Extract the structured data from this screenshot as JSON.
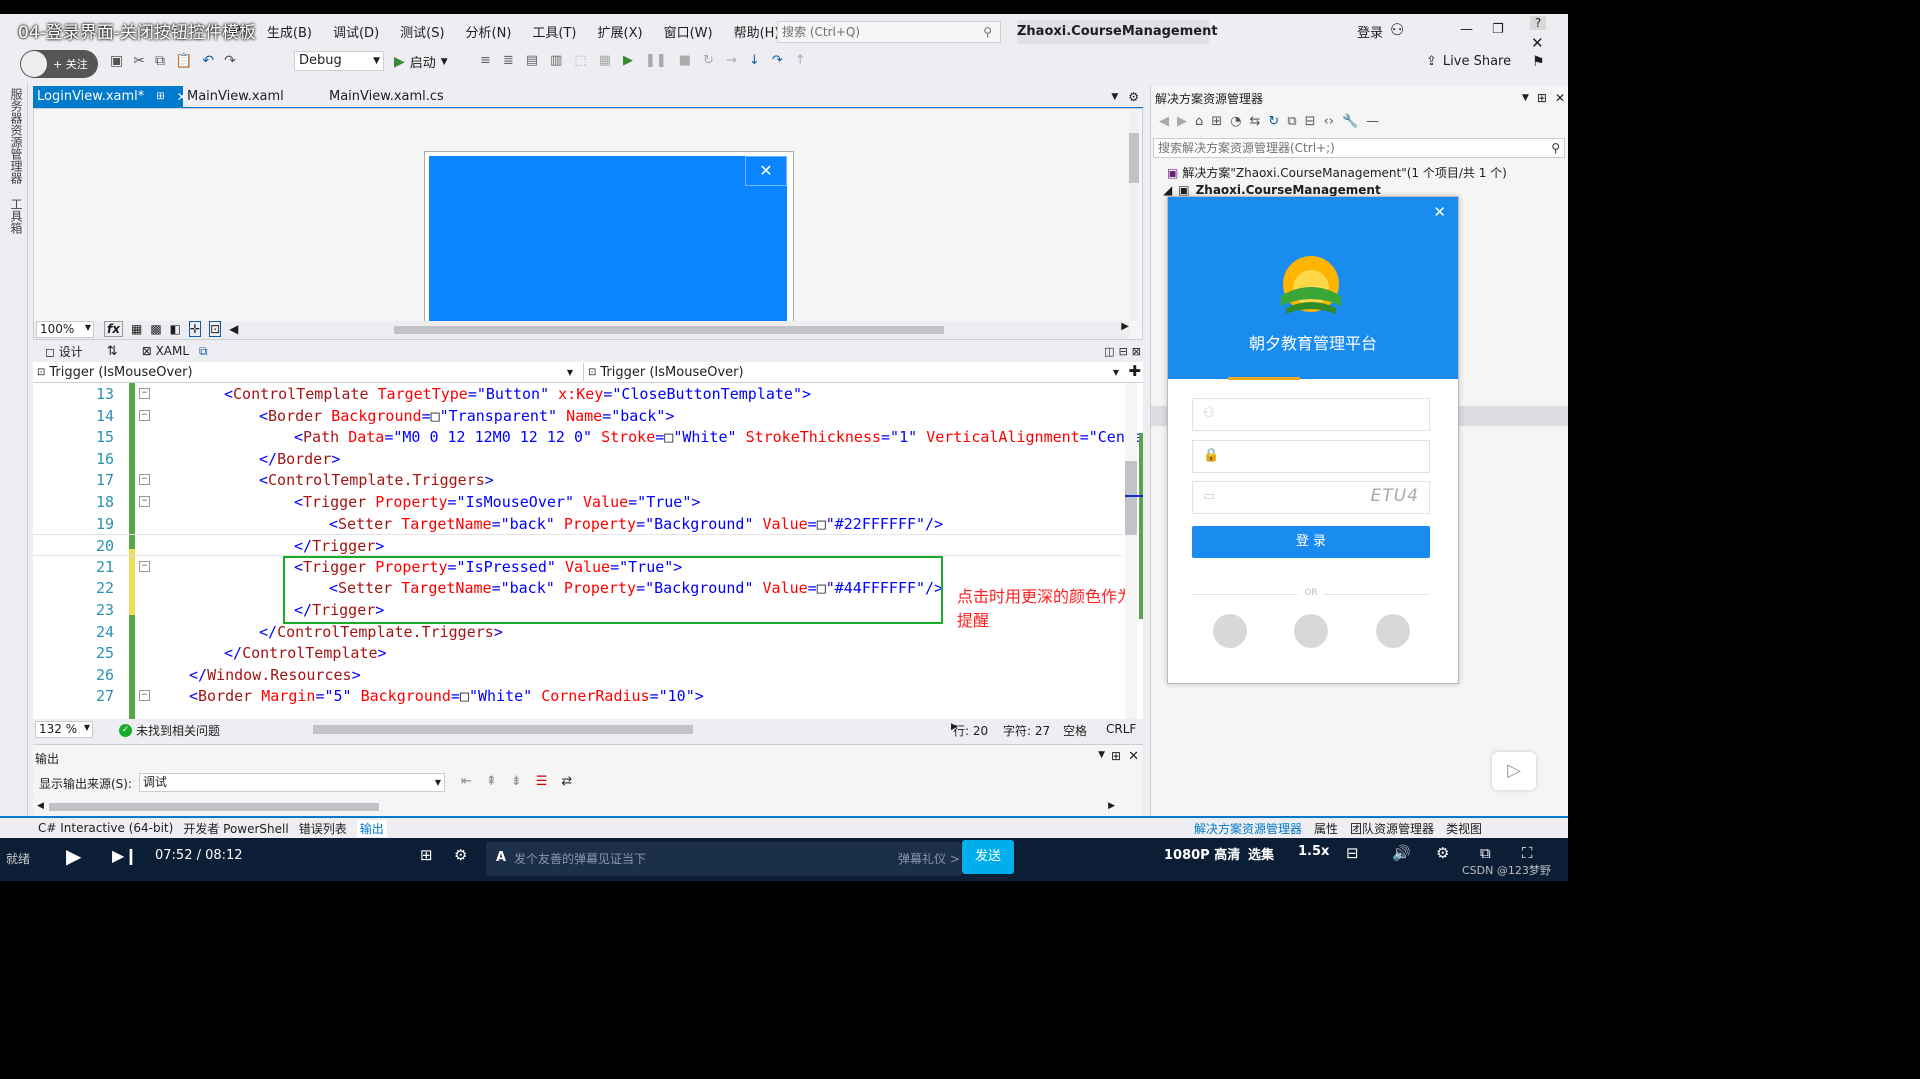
{
  "video_title": "04-登录界面-关闭按钮控件模板",
  "menu": [
    "P)",
    "生成(B)",
    "调试(D)",
    "测试(S)",
    "分析(N)",
    "工具(T)",
    "扩展(X)",
    "窗口(W)",
    "帮助(H)"
  ],
  "search_placeholder": "搜索 (Ctrl+Q)",
  "project_name": "Zhaoxi.CourseManagement",
  "login_label": "登录",
  "follow_label": "+ 关注",
  "config": "Debug",
  "start_label": "启动",
  "live_share": "Live Share",
  "left_strip": [
    "服务器资源管理器",
    "工具箱"
  ],
  "tabs": [
    {
      "label": "LoginView.xaml*",
      "active": true
    },
    {
      "label": "MainView.xaml",
      "active": false
    },
    {
      "label": "MainView.xaml.cs",
      "active": false
    }
  ],
  "designer": {
    "zoom": "100%",
    "design_tab": "设计",
    "xaml_tab": "XAML"
  },
  "combo_left": "Trigger (IsMouseOver)",
  "combo_right": "Trigger (IsMouseOver)",
  "code_lines": [
    {
      "n": "13",
      "html": "<span class=\"p\">&lt;</span><span class=\"t\">ControlTemplate</span> <span class=\"a\">TargetType</span><span class=\"p\">=\"</span><span class=\"v\">Button</span><span class=\"p\">\"</span> <span class=\"a\">x:Key</span><span class=\"p\">=\"</span><span class=\"v\">CloseButtonTemplate</span><span class=\"p\">\"&gt;</span>",
      "indent": 2
    },
    {
      "n": "14",
      "html": "<span class=\"p\">&lt;</span><span class=\"t\">Border</span> <span class=\"a\">Background</span><span class=\"p\">=</span>□<span class=\"p\">\"</span><span class=\"v\">Transparent</span><span class=\"p\">\"</span> <span class=\"a\">Name</span><span class=\"p\">=\"</span><span class=\"v\">back</span><span class=\"p\">\"&gt;</span>",
      "indent": 3
    },
    {
      "n": "15",
      "html": "<span class=\"p\">&lt;</span><span class=\"t\">Path</span> <span class=\"a\">Data</span><span class=\"p\">=\"</span><span class=\"v\">M0 0 12 12M0 12 12 0</span><span class=\"p\">\"</span> <span class=\"a\">Stroke</span><span class=\"p\">=</span>□<span class=\"p\">\"</span><span class=\"v\">White</span><span class=\"p\">\"</span> <span class=\"a\">StrokeThickness</span><span class=\"p\">=\"</span><span class=\"v\">1</span><span class=\"p\">\"</span> <span class=\"a\">VerticalAlignment</span><span class=\"p\">=\"</span><span class=\"v\">Cente</span>",
      "indent": 4
    },
    {
      "n": "16",
      "html": "<span class=\"p\">&lt;/</span><span class=\"t\">Border</span><span class=\"p\">&gt;</span>",
      "indent": 3
    },
    {
      "n": "17",
      "html": "<span class=\"p\">&lt;</span><span class=\"t\">ControlTemplate.Triggers</span><span class=\"p\">&gt;</span>",
      "indent": 3
    },
    {
      "n": "18",
      "html": "<span class=\"p\">&lt;</span><span class=\"t\">Trigger</span> <span class=\"a\">Property</span><span class=\"p\">=\"</span><span class=\"v\">IsMouseOver</span><span class=\"p\">\"</span> <span class=\"a\">Value</span><span class=\"p\">=\"</span><span class=\"v\">True</span><span class=\"p\">\"&gt;</span>",
      "indent": 4
    },
    {
      "n": "19",
      "html": "<span class=\"p\">&lt;</span><span class=\"t\">Setter</span> <span class=\"a\">TargetName</span><span class=\"p\">=\"</span><span class=\"v\">back</span><span class=\"p\">\"</span> <span class=\"a\">Property</span><span class=\"p\">=\"</span><span class=\"v\">Background</span><span class=\"p\">\"</span> <span class=\"a\">Value</span><span class=\"p\">=</span>□<span class=\"p\">\"</span><span class=\"v\">#22FFFFFF</span><span class=\"p\">\"/&gt;</span>",
      "indent": 5
    },
    {
      "n": "20",
      "html": "<span class=\"p\">&lt;/</span><span class=\"t\">Trigger</span><span class=\"p\">&gt;</span>",
      "indent": 4
    },
    {
      "n": "21",
      "html": "<span class=\"p\">&lt;</span><span class=\"t\">Trigger</span> <span class=\"a\">Property</span><span class=\"p\">=\"</span><span class=\"v\">IsPressed</span><span class=\"p\">\"</span> <span class=\"a\">Value</span><span class=\"p\">=\"</span><span class=\"v\">True</span><span class=\"p\">\"&gt;</span>",
      "indent": 4
    },
    {
      "n": "22",
      "html": "<span class=\"p\">&lt;</span><span class=\"t\">Setter</span> <span class=\"a\">TargetName</span><span class=\"p\">=\"</span><span class=\"v\">back</span><span class=\"p\">\"</span> <span class=\"a\">Property</span><span class=\"p\">=\"</span><span class=\"v\">Background</span><span class=\"p\">\"</span> <span class=\"a\">Value</span><span class=\"p\">=</span>□<span class=\"p\">\"</span><span class=\"v\">#44FFFFFF</span><span class=\"p\">\"/&gt;</span>",
      "indent": 5
    },
    {
      "n": "23",
      "html": "<span class=\"p\">&lt;/</span><span class=\"t\">Trigger</span><span class=\"p\">&gt;</span>",
      "indent": 4
    },
    {
      "n": "24",
      "html": "<span class=\"p\">&lt;/</span><span class=\"t\">ControlTemplate.Triggers</span><span class=\"p\">&gt;</span>",
      "indent": 3
    },
    {
      "n": "25",
      "html": "<span class=\"p\">&lt;/</span><span class=\"t\">ControlTemplate</span><span class=\"p\">&gt;</span>",
      "indent": 2
    },
    {
      "n": "26",
      "html": "<span class=\"p\">&lt;/</span><span class=\"t\">Window.Resources</span><span class=\"p\">&gt;</span>",
      "indent": 1
    },
    {
      "n": "27",
      "html": "<span class=\"p\">&lt;</span><span class=\"t\">Border</span> <span class=\"a\">Margin</span><span class=\"p\">=\"</span><span class=\"v\">5</span><span class=\"p\">\"</span> <span class=\"a\">Background</span><span class=\"p\">=</span>□<span class=\"p\">\"</span><span class=\"v\">White</span><span class=\"p\">\"</span> <span class=\"a\">CornerRadius</span><span class=\"p\">=\"</span><span class=\"v\">10</span><span class=\"p\">\"&gt;</span>",
      "indent": 1
    }
  ],
  "annotation": "点击时用更深的颜色作为提醒",
  "editor_status": {
    "zoom": "132 %",
    "issues": "未找到相关问题",
    "row": "行: 20",
    "col": "字符: 27",
    "space": "空格",
    "eol": "CRLF"
  },
  "output": {
    "title": "输出",
    "source_label": "显示输出来源(S):",
    "source_value": "调试"
  },
  "bottom_tabs": [
    "C# Interactive (64-bit)",
    "开发者 PowerShell",
    "错误列表",
    "输出"
  ],
  "right_bottom_tabs": [
    "解决方案资源管理器",
    "属性",
    "团队资源管理器",
    "类视图"
  ],
  "solution": {
    "title": "解决方案资源管理器",
    "search_placeholder": "搜索解决方案资源管理器(Ctrl+;)",
    "root": "解决方案\"Zhaoxi.CourseManagement\"(1 个项目/共 1 个)",
    "project": "Zhaoxi.CourseManagement"
  },
  "login_window": {
    "title": "朝夕教育管理平台",
    "captcha": "ETU4",
    "button": "登   录",
    "or": "OR",
    "colors": {
      "header": "#1a8cf0",
      "button": "#1a8cf0",
      "accent": "#f5a623"
    }
  },
  "video": {
    "time": "07:52 / 08:12",
    "danmaku_placeholder": "发个友善的弹幕见证当下",
    "danmaku_label": "弹幕礼仪 >",
    "send": "发送",
    "quality": "1080P 高清",
    "episodes": "选集",
    "speed": "1.5x",
    "ready": "就绪",
    "watermark": "CSDN @123梦野"
  }
}
